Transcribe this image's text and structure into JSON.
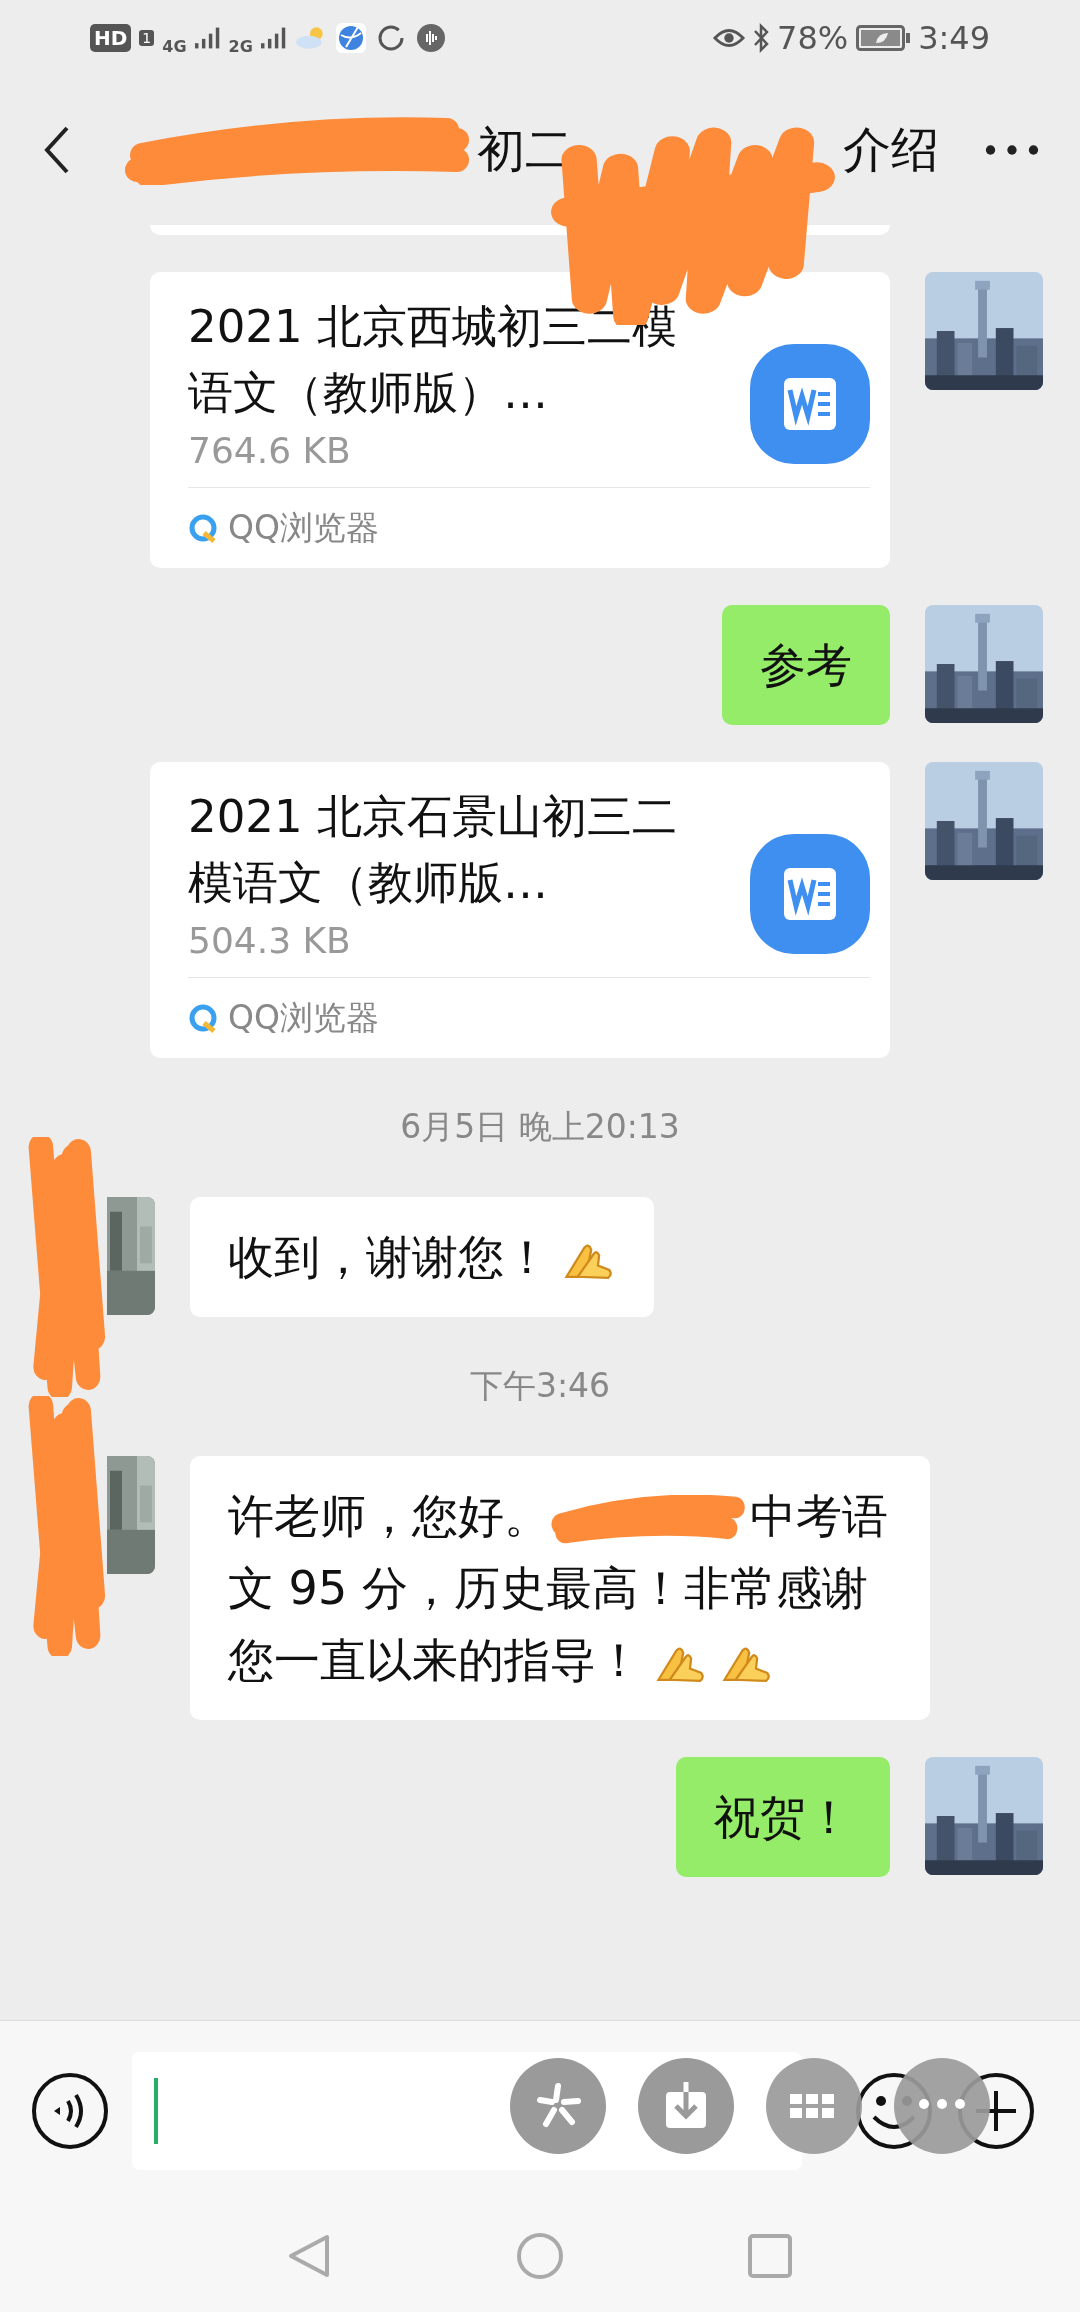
{
  "status_bar": {
    "hd": "HD",
    "sim": "1",
    "network_1": "4G",
    "network_2": "2G",
    "battery": "78%",
    "time": "3:49"
  },
  "title_bar": {
    "title_fragments": [
      "初二",
      "介绍"
    ]
  },
  "messages": [
    {
      "kind": "file",
      "outgoing": true,
      "file_name": "2021 北京西城初三二模语文（教师版）…",
      "size": "764.6 KB",
      "source": "QQ浏览器"
    },
    {
      "kind": "text",
      "outgoing": true,
      "parts": [
        {
          "kind": "text",
          "text": "参考"
        }
      ]
    },
    {
      "kind": "file",
      "outgoing": true,
      "file_name": "2021 北京石景山初三二模语文（教师版…",
      "size": "504.3 KB",
      "source": "QQ浏览器"
    },
    {
      "kind": "time",
      "text": "6月5日 晚上20:13"
    },
    {
      "kind": "text",
      "outgoing": false,
      "parts": [
        {
          "kind": "text",
          "text": "收到，谢谢您！"
        },
        {
          "kind": "emoji"
        }
      ]
    },
    {
      "kind": "time",
      "text": "下午3:46"
    },
    {
      "kind": "text",
      "outgoing": false,
      "parts": [
        {
          "kind": "text",
          "text": "许老师，您好。"
        },
        {
          "kind": "redacted"
        },
        {
          "kind": "text",
          "text": "中考语文 95 分，历史最高！非常感谢您一直以来的指导！"
        },
        {
          "kind": "emoji"
        },
        {
          "kind": "emoji"
        }
      ]
    },
    {
      "kind": "text",
      "outgoing": true,
      "parts": [
        {
          "kind": "text",
          "text": "祝贺！"
        }
      ]
    }
  ]
}
